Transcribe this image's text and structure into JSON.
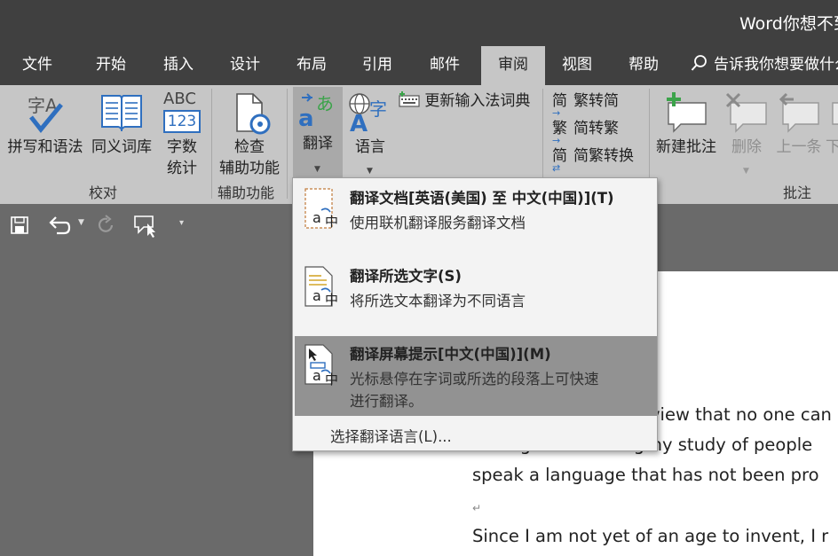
{
  "window": {
    "title": "Word你想不到"
  },
  "tabs": [
    {
      "label": "文件"
    },
    {
      "label": "开始"
    },
    {
      "label": "插入"
    },
    {
      "label": "设计"
    },
    {
      "label": "布局"
    },
    {
      "label": "引用"
    },
    {
      "label": "邮件"
    },
    {
      "label": "审阅"
    },
    {
      "label": "视图"
    },
    {
      "label": "帮助"
    }
  ],
  "tell_me": "告诉我你想要做什么",
  "ribbon": {
    "spelling": "拼写和语法",
    "thesaurus": "同义词库",
    "word_count_1": "字数",
    "word_count_2": "统计",
    "icon_abc": "ABC",
    "icon_123": "123",
    "icon_zi_a": "字A",
    "check_1": "检查",
    "check_2": "辅助功能",
    "translate": "翻译",
    "language": "语言",
    "update_ime": "更新输入法词典",
    "trad_to_simp": "繁转简",
    "simp_to_trad": "简转繁",
    "simp_trad_convert": "简繁转换",
    "icon_jian": "简",
    "icon_fan": "繁",
    "icon_jian2": "简",
    "new_comment": "新建批注",
    "delete": "删除",
    "previous": "上一条",
    "next": "下",
    "groups": {
      "proofing": "校对",
      "accessibility": "辅助功能",
      "comments": "批注"
    }
  },
  "menu": {
    "items": [
      {
        "title": "翻译文档[英语(美国) 至 中文(中国)](T)",
        "desc": "使用联机翻译服务翻译文档"
      },
      {
        "title": "翻译所选文字(S)",
        "desc": "将所选文本翻译为不同语言"
      },
      {
        "title": "翻译屏幕提示[中文(中国)](M)",
        "desc1": "光标悬停在字词或所选的段落上可快速",
        "desc2": "进行翻译。"
      }
    ],
    "choose_language": "选择翻译语言(L)...",
    "icon_a": "a",
    "icon_zhong": "中"
  },
  "document": {
    "line1": "view that no one can",
    "line2": "having made a lengthy study of people",
    "line3": "speak a language that has not been pro",
    "para_mark": "↵",
    "line4": "Since I am not yet of an age to invent, I r"
  },
  "colors": {
    "title_bg": "#404040",
    "ribbon_bg": "#c6c6c6",
    "canvas_bg": "#6a6a6a",
    "accent_blue": "#2f6fbf",
    "accent_green": "#3ba34a"
  }
}
